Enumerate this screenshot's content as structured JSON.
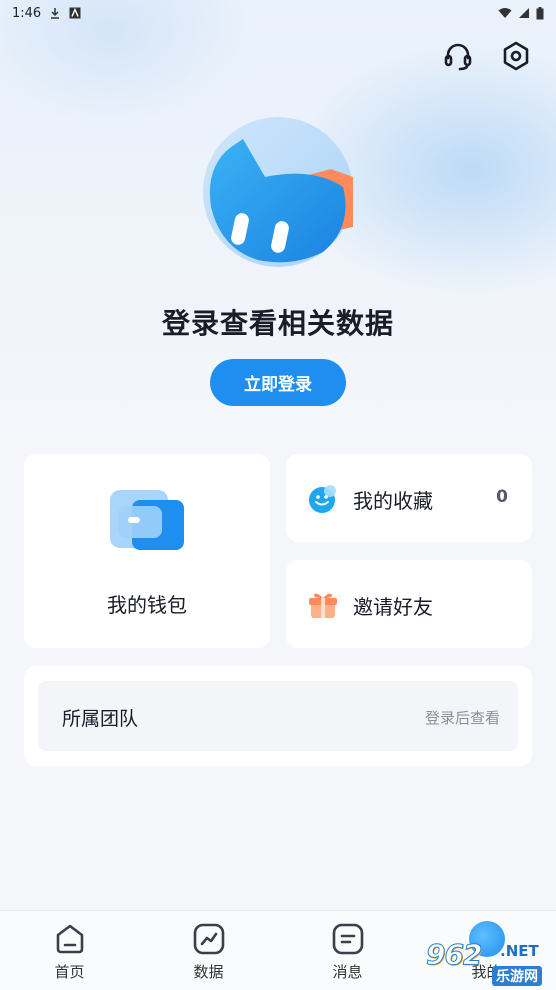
{
  "status_bar": {
    "time": "1:46"
  },
  "header": {
    "support_icon": "headset-icon",
    "settings_icon": "settings-hexagon-icon"
  },
  "profile": {
    "avatar_icon": "cat-mascot-avatar",
    "title": "登录查看相关数据",
    "login_button": "立即登录"
  },
  "cards": {
    "wallet": {
      "label": "我的钱包",
      "icon": "wallet-icon"
    },
    "favorites": {
      "label": "我的收藏",
      "count": "0",
      "icon": "smile-face-icon"
    },
    "invite": {
      "label": "邀请好友",
      "icon": "gift-icon"
    },
    "team": {
      "label": "所属团队",
      "hint": "登录后查看"
    }
  },
  "tabbar": {
    "items": [
      {
        "label": "首页",
        "icon": "home-icon"
      },
      {
        "label": "数据",
        "icon": "chart-icon"
      },
      {
        "label": "消息",
        "icon": "message-icon"
      },
      {
        "label": "我的",
        "icon": "profile-icon"
      }
    ]
  },
  "watermark": {
    "main": "962",
    "net": ".NET",
    "sub": "乐游网"
  },
  "colors": {
    "accent": "#1f8ef1",
    "background": "#f4f6fa",
    "card": "#ffffff",
    "orange": "#ff8a5b"
  }
}
